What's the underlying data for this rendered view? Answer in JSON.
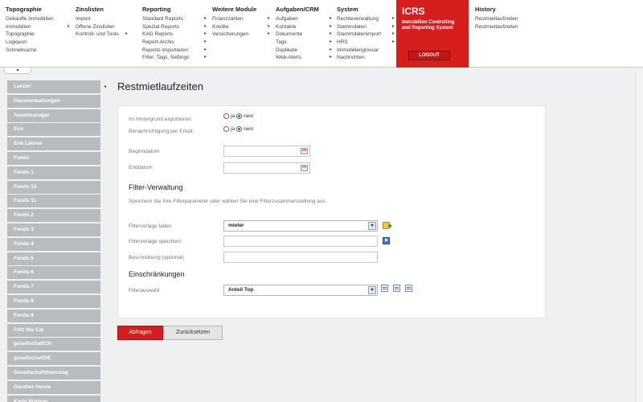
{
  "menu": [
    {
      "title": "Topographie",
      "items": [
        {
          "label": "Gekaufte Immobilien",
          "arrow": false
        },
        {
          "label": "Immobilien",
          "arrow": true
        },
        {
          "label": "Topographie",
          "arrow": false
        },
        {
          "label": "Logiquon",
          "arrow": false
        },
        {
          "label": "Schnellsuche",
          "arrow": false
        }
      ]
    },
    {
      "title": "Zinslisten",
      "items": [
        {
          "label": "Import",
          "arrow": false
        },
        {
          "label": "Offene Zinslisten",
          "arrow": false
        },
        {
          "label": "Kontroll- und Tools",
          "arrow": true
        }
      ]
    },
    {
      "title": "Reporting",
      "items": [
        {
          "label": "Standard Reports",
          "arrow": true
        },
        {
          "label": "Spezial Reports",
          "arrow": true
        },
        {
          "label": "KAG Reports",
          "arrow": true
        },
        {
          "label": "Report-Archiv",
          "arrow": true
        },
        {
          "label": "Reports importieren",
          "arrow": true
        },
        {
          "label": "Filter, Tags, Settings",
          "arrow": true
        }
      ]
    },
    {
      "title": "Weitere Module",
      "items": [
        {
          "label": "Finanzzahlen",
          "arrow": true
        },
        {
          "label": "Kredite",
          "arrow": true
        },
        {
          "label": "Versicherungen",
          "arrow": true
        }
      ]
    },
    {
      "title": "Aufgaben/CRM",
      "items": [
        {
          "label": "Aufgaben",
          "arrow": true
        },
        {
          "label": "Kontakte",
          "arrow": true
        },
        {
          "label": "Dokumente",
          "arrow": true
        },
        {
          "label": "Tags",
          "arrow": true
        },
        {
          "label": "Duplikate",
          "arrow": true
        },
        {
          "label": "Web-Alerts",
          "arrow": true
        }
      ]
    },
    {
      "title": "System",
      "items": [
        {
          "label": "Rechteverwaltung",
          "arrow": true
        },
        {
          "label": "Stammdaten",
          "arrow": true
        },
        {
          "label": "Stammdatenimport",
          "arrow": true
        },
        {
          "label": "HRS",
          "arrow": true
        },
        {
          "label": "Immobilienglossar",
          "arrow": false
        },
        {
          "label": "Nachrichten",
          "arrow": false
        }
      ]
    }
  ],
  "brand": {
    "name": "ICRS",
    "subtitle_line1": "Immobilien Controlling",
    "subtitle_line2": "and Reporting System",
    "logout_label": "LOGOUT",
    "color": "#d61e1e"
  },
  "history": {
    "title": "History",
    "items": [
      "Restmietlaufzeiten",
      "Restmietlaufzeiten"
    ]
  },
  "sidebar": {
    "items": [
      "Lander",
      "Hausverwaltungen",
      "Assetmanager",
      "Eco",
      "Erik Labree",
      "Fonds",
      "Fonds 1",
      "Fonds 10",
      "Fonds 11",
      "Fonds 2",
      "Fonds 3",
      "Fonds 4",
      "Fonds 5",
      "Fonds 6",
      "Fonds 7",
      "Fonds 8",
      "Fonds 9",
      "Fritz the Cat",
      "gesellschaftCH",
      "gesellschaftDE",
      "Gesellschaftthomstag",
      "Günther Henze",
      "Karlo Wartner"
    ]
  },
  "page": {
    "title": "Restmietlaufzeiten"
  },
  "form": {
    "export_label": "Im Hintergrund exportieren:",
    "notify_label": "Benachrichtigung per Email:",
    "ja": "ja",
    "nein": "nein",
    "begin_label": "Beginndatum",
    "end_label": "Enddatum",
    "filter_heading": "Filter-Verwaltung",
    "filter_hint": "Speichern Sie Ihre Filterparameter oder wählen Sie eine Filterzusammenstellung aus.",
    "template_load_label": "Filtervorlage laden",
    "template_load_value": "mieter",
    "template_save_label": "Filtervorlage speichern",
    "description_label": "Beschreibung (optional)",
    "restrictions_heading": "Einschränkungen",
    "filter_select_label": "Filterauswahl",
    "filter_select_value": "Anteil Top"
  },
  "buttons": {
    "query": "Abfragen",
    "reset": "Zurücksetzen"
  }
}
